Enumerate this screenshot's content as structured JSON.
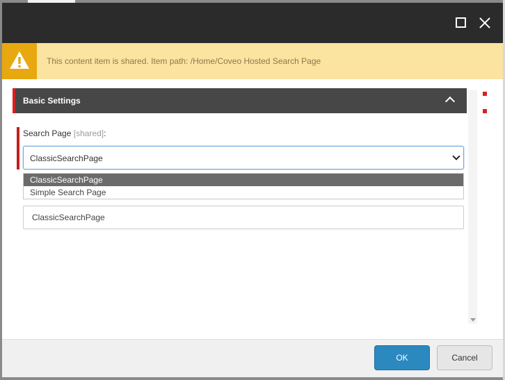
{
  "titlebar": {
    "maximize_icon": "maximize-icon",
    "close_icon": "close-icon"
  },
  "warning": {
    "icon": "warning-icon",
    "message": "This content item is shared. Item path: /Home/Coveo Hosted Search Page"
  },
  "section": {
    "title": "Basic Settings",
    "toggle_icon": "chevron-up-icon"
  },
  "field": {
    "label": "Search Page",
    "shared_tag": "[shared]",
    "label_suffix": ":",
    "selected_value": "ClassicSearchPage",
    "options": [
      "ClassicSearchPage",
      "Simple Search Page"
    ]
  },
  "text_input": {
    "value": "ClassicSearchPage"
  },
  "footer": {
    "ok_label": "OK",
    "cancel_label": "Cancel"
  },
  "colors": {
    "titlebar": "#2b2b2b",
    "warning_bg": "#fbe3a0",
    "warning_icon_bg": "#e8a80f",
    "section_bg": "#474747",
    "accent_red": "#d82020",
    "ok_button": "#2b89c0"
  }
}
